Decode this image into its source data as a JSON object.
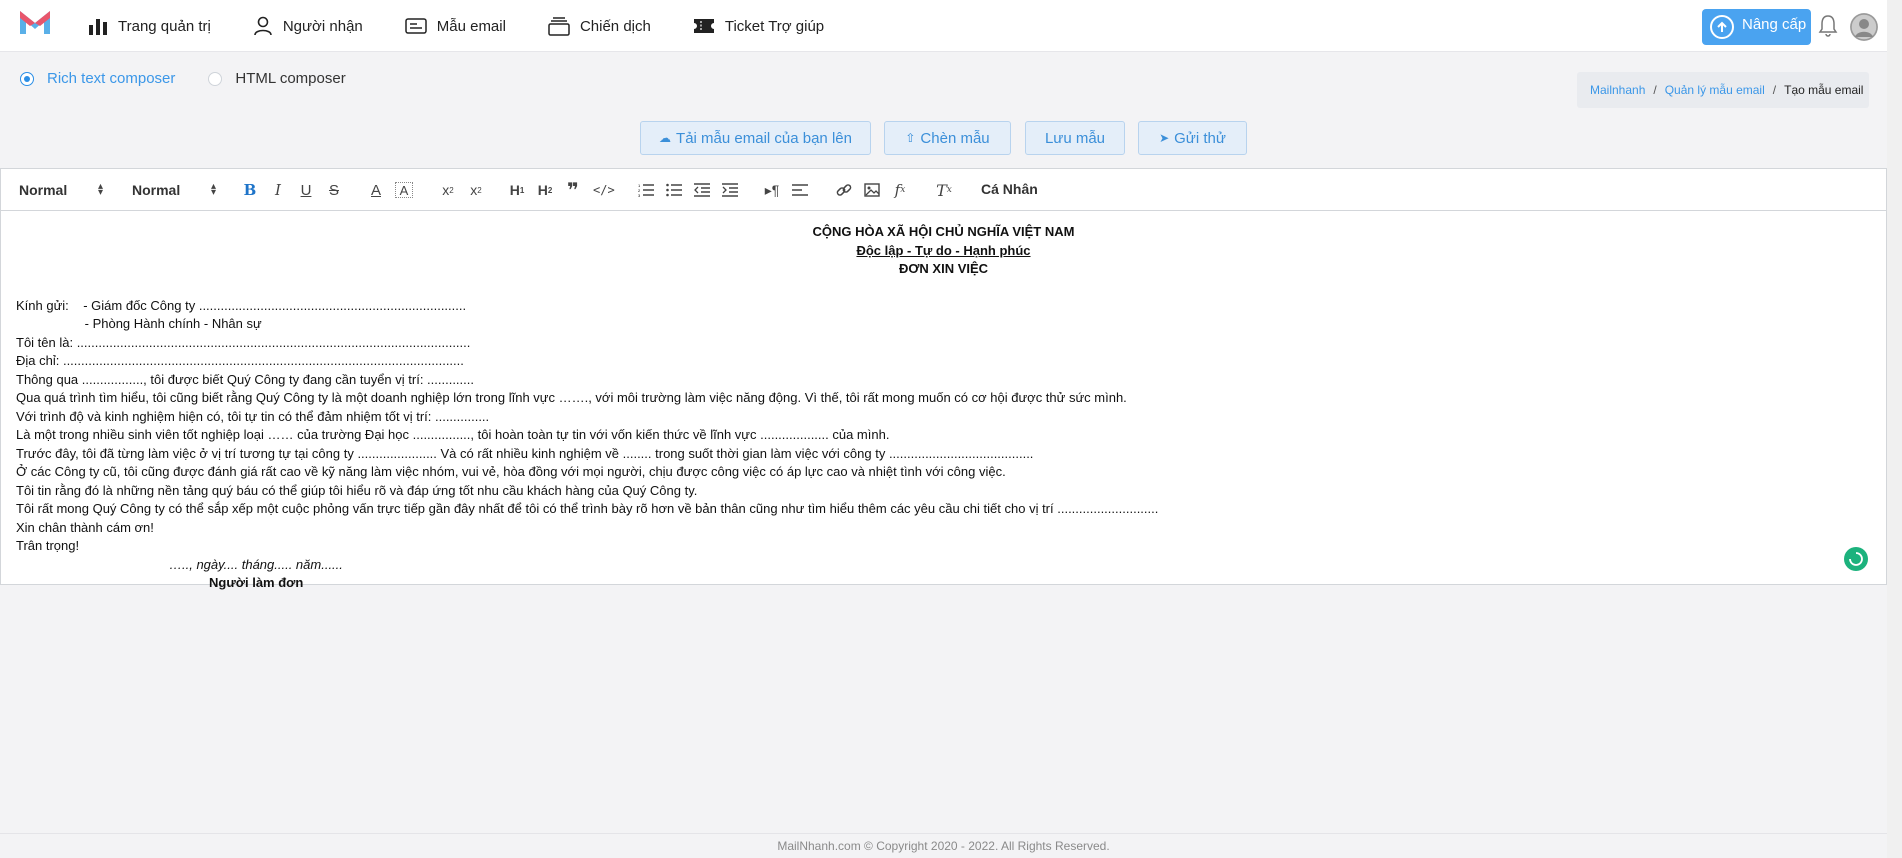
{
  "nav": {
    "items": [
      {
        "label": "Trang quản trị",
        "icon": "bar-chart-icon"
      },
      {
        "label": "Người nhận",
        "icon": "user-icon"
      },
      {
        "label": "Mẫu email",
        "icon": "email-template-icon"
      },
      {
        "label": "Chiến dịch",
        "icon": "stack-icon"
      },
      {
        "label": "Ticket Trợ giúp",
        "icon": "ticket-icon"
      }
    ],
    "upgrade_label": "Nâng cấp"
  },
  "composer": {
    "options": [
      "Rich text composer",
      "HTML composer"
    ],
    "selected": "Rich text composer"
  },
  "breadcrumb": {
    "items": [
      "Mailnhanh",
      "Quản lý mẫu email",
      "Tạo mẫu email"
    ]
  },
  "actions": {
    "upload": "Tải mẫu email của bạn lên",
    "insert": "Chèn mẫu",
    "save": "Lưu mẫu",
    "send": "Gửi thử"
  },
  "toolbar": {
    "font_select": "Normal",
    "size_select": "Normal",
    "personal": "Cá Nhân"
  },
  "document": {
    "header1": "CỘNG HÒA XÃ HỘI CHỦ NGHĨA VIỆT NAM",
    "header2": "Độc lập - Tự do - Hạnh phúc",
    "header3": "ĐƠN XIN VIỆC",
    "lines": [
      "Kính gửi:    - Giám đốc Công ty ..........................................................................",
      "                   - Phòng Hành chính - Nhân sự",
      "Tôi tên là: .............................................................................................................",
      "Địa chỉ: ...............................................................................................................",
      "Thông qua ................., tôi được biết Quý Công ty đang cần tuyển vị trí: .............",
      "Qua quá trình tìm hiểu, tôi cũng biết rằng Quý Công ty là một doanh nghiệp lớn trong lĩnh vực ……., với môi trường làm việc năng động. Vì thế, tôi rất mong muốn có cơ hội được thử sức mình.",
      "Với trình độ và kinh nghiệm hiện có, tôi tự tin có thể đảm nhiệm tốt vị trí: ...............",
      "Là một trong nhiều sinh viên tốt nghiệp loại …… của trường Đại học ................, tôi hoàn toàn tự tin với vốn kiến thức về lĩnh vực ................... của mình.",
      "Trước đây, tôi đã từng làm việc ở vị trí tương tự tại công ty ...................... Và có rất nhiều kinh nghiệm về ........ trong suốt thời gian làm việc với công ty ........................................",
      "Ở các Công ty cũ, tôi cũng được đánh giá rất cao về kỹ năng làm việc nhóm, vui vẻ, hòa đồng với mọi người, chịu được công việc có áp lực cao và nhiệt tình với công việc.",
      "Tôi tin rằng đó là những nền tảng quý báu có thể giúp tôi hiểu rõ và đáp ứng tốt nhu cầu khách hàng của Quý Công ty.",
      "Tôi rất mong Quý Công ty có thể sắp xếp một cuộc phỏng vấn trực tiếp gần đây nhất để tôi có thể trình bày rõ hơn về bản thân cũng như tìm hiểu thêm các yêu cầu chi tiết cho vị trí ............................",
      "Xin chân thành cám ơn!",
      "Trân trọng!"
    ],
    "date_line": "….., ngày.... tháng..... năm......",
    "signature": "Người làm đơn"
  },
  "footer": {
    "text": "MailNhanh.com © Copyright 2020 - 2022. All Rights Reserved."
  },
  "colors": {
    "accent": "#3b97e8",
    "upgrade_bg": "#4aa3f0",
    "loading": "#1cb27d"
  }
}
